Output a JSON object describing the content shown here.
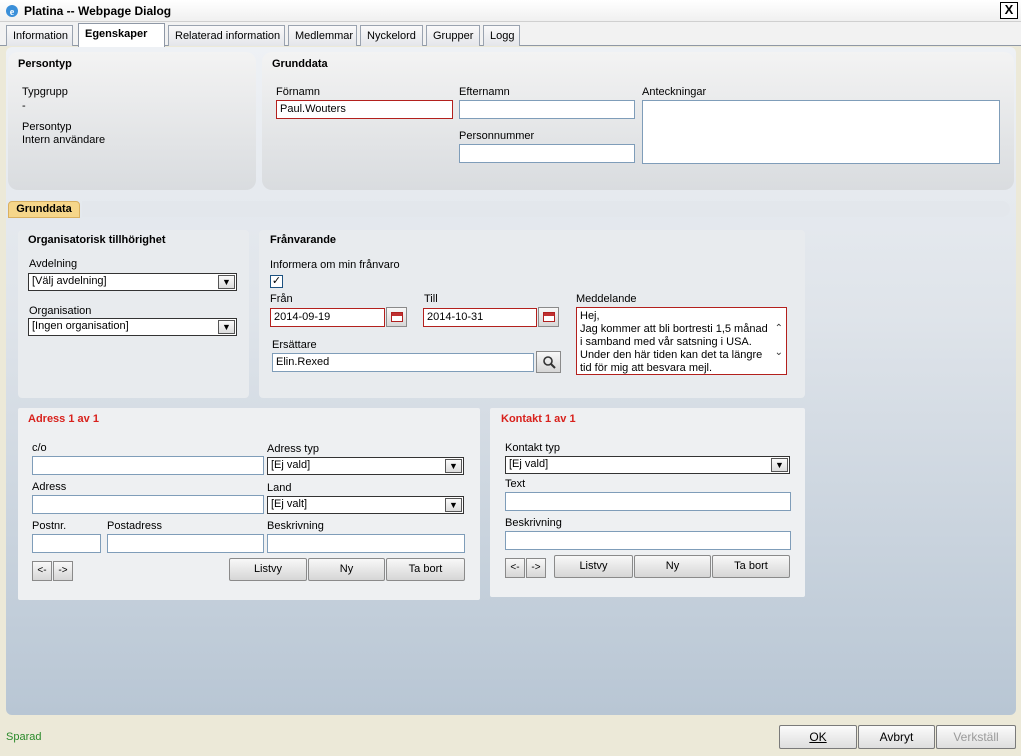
{
  "window": {
    "title": "Platina -- Webpage Dialog",
    "close_symbol": "X"
  },
  "tabs": [
    "Information",
    "Egenskaper",
    "Relaterad information",
    "Medlemmar",
    "Nyckelord",
    "Grupper",
    "Logg"
  ],
  "persontyp": {
    "heading": "Persontyp",
    "typgrupp_label": "Typgrupp",
    "typgrupp_value": "-",
    "persontyp_label": "Persontyp",
    "persontyp_value": "Intern användare"
  },
  "grunddata": {
    "heading": "Grunddata",
    "fornamn_label": "Förnamn",
    "fornamn_value": "Paul.Wouters",
    "efternamn_label": "Efternamn",
    "efternamn_value": "",
    "personnummer_label": "Personnummer",
    "personnummer_value": "",
    "anteckningar_label": "Anteckningar",
    "anteckningar_value": ""
  },
  "section_tab": "Grunddata",
  "org": {
    "heading": "Organisatorisk tillhörighet",
    "avdelning_label": "Avdelning",
    "avdelning_value": "[Välj avdelning]",
    "organisation_label": "Organisation",
    "organisation_value": "[Ingen organisation]"
  },
  "franvarande": {
    "heading": "Frånvarande",
    "informera_label": "Informera om min frånvaro",
    "informera_checked": "✓",
    "fran_label": "Från",
    "fran_value": "2014-09-19",
    "till_label": "Till",
    "till_value": "2014-10-31",
    "meddelande_label": "Meddelande",
    "meddelande_lines": [
      "Hej,",
      "Jag kommer att bli bortresti 1,5 månad",
      "i samband med vår satsning i USA.",
      "Under den här tiden kan det ta längre",
      "tid för mig att besvara mejl."
    ],
    "ersattare_label": "Ersättare",
    "ersattare_value": "Elin.Rexed"
  },
  "adress": {
    "heading": "Adress 1 av 1",
    "co_label": "c/o",
    "adresstyp_label": "Adress typ",
    "adresstyp_value": "[Ej vald]",
    "adress_label": "Adress",
    "land_label": "Land",
    "land_value": "[Ej valt]",
    "postnr_label": "Postnr.",
    "postadress_label": "Postadress",
    "beskrivning_label": "Beskrivning",
    "prev": "<-",
    "next": "->",
    "listvy": "Listvy",
    "ny": "Ny",
    "ta_bort": "Ta bort"
  },
  "kontakt": {
    "heading": "Kontakt 1 av 1",
    "kontakttyp_label": "Kontakt typ",
    "kontakttyp_value": "[Ej vald]",
    "text_label": "Text",
    "beskrivning_label": "Beskrivning",
    "prev": "<-",
    "next": "->",
    "listvy": "Listvy",
    "ny": "Ny",
    "ta_bort": "Ta bort"
  },
  "status": {
    "text": "Sparad",
    "color": "#2a8a2a"
  },
  "buttons": {
    "ok": "OK",
    "avbryt": "Avbryt",
    "verkstall": "Verkställ"
  },
  "colors": {
    "accent_red": "#d8211c",
    "tab_highlight": "#f6d68a"
  }
}
